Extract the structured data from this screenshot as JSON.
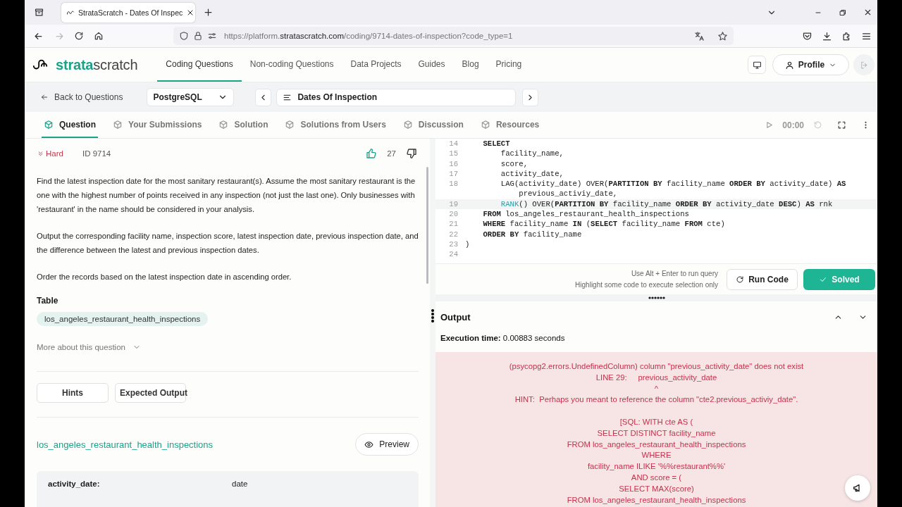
{
  "browser": {
    "tab_title": "StrataScratch - Dates Of Inspec",
    "url": {
      "prefix": "https://platform.",
      "domain": "stratascratch.com",
      "path": "/coding/9714-dates-of-inspection?code_type=1"
    }
  },
  "site": {
    "logo_a": "strata",
    "logo_b": "scratch",
    "profile": "Profile",
    "nav": [
      {
        "label": "Coding Questions",
        "selected": true
      },
      {
        "label": "Non-coding Questions",
        "selected": false
      },
      {
        "label": "Data Projects",
        "selected": false
      },
      {
        "label": "Guides",
        "selected": false
      },
      {
        "label": "Blog",
        "selected": false
      },
      {
        "label": "Pricing",
        "selected": false
      }
    ]
  },
  "toolbar": {
    "back": "Back to Questions",
    "language": "PostgreSQL",
    "question_title": "Dates Of Inspection"
  },
  "tabs": [
    {
      "label": "Question",
      "selected": true
    },
    {
      "label": "Your Submissions",
      "selected": false
    },
    {
      "label": "Solution",
      "selected": false
    },
    {
      "label": "Solutions from Users",
      "selected": false
    },
    {
      "label": "Discussion",
      "selected": false
    },
    {
      "label": "Resources",
      "selected": false
    }
  ],
  "timer": "00:00",
  "question": {
    "difficulty": "Hard",
    "id": "ID 9714",
    "likes": "27",
    "paragraphs": [
      "Find the latest inspection date for the most sanitary restaurant(s). Assume the most sanitary restaurant is the one with the highest number of points received in any inspection (not just the last one). Only businesses with 'restaurant' in the name should be considered in your analysis.",
      "Output the corresponding facility name, inspection score, latest inspection date, previous inspection date, and the difference between the latest and previous inspection dates.",
      "Order the records based on the latest inspection date in ascending order."
    ],
    "table_heading": "Table",
    "table_chip": "los_angeles_restaurant_health_inspections",
    "more": "More about this question",
    "buttons": [
      "Hints",
      "Expected Output"
    ],
    "dataset_link": "los_angeles_restaurant_health_inspections",
    "preview": "Preview",
    "schema": [
      {
        "column": "activity_date:",
        "type": "date"
      }
    ]
  },
  "editor": {
    "lines": [
      {
        "number": "14",
        "text": "    **SELECT**",
        "active": false
      },
      {
        "number": "15",
        "text": "        facility_name,",
        "active": false
      },
      {
        "number": "16",
        "text": "        score,",
        "active": false
      },
      {
        "number": "17",
        "text": "        activity_date,",
        "active": false
      },
      {
        "number": "18",
        "text": "        LAG(activity_date) OVER(**PARTITION BY** facility_name **ORDER BY** activity_date) **AS**",
        "active": false
      },
      {
        "text": "            previous_activiy_date,",
        "active": false
      },
      {
        "number": "19",
        "text": "        *RANK*() OVER(**PARTITION BY** facility_name **ORDER BY** activity_date **DESC**) **AS** rnk",
        "active": true
      },
      {
        "number": "20",
        "text": "    **FROM** los_angeles_restaurant_health_inspections",
        "active": false
      },
      {
        "number": "21",
        "text": "    **WHERE** facility_name **IN** (**SELECT** facility_name **FROM** cte)",
        "active": false
      },
      {
        "number": "22",
        "text": "    **ORDER BY** facility_name",
        "active": false
      },
      {
        "number": "23",
        "text": ")",
        "active": false
      },
      {
        "number": "24",
        "active": false
      }
    ],
    "hints": [
      "Use Alt + Enter to run query",
      "Highlight some code to execute selection only"
    ],
    "run": "Run Code",
    "status": "Solved"
  },
  "output": {
    "title": "Output",
    "execution_label": "Execution time:",
    "execution_value": "0.00883 seconds",
    "error_blocks": [
      [
        "(psycopg2.errors.UndefinedColumn) column \"previous_activity_date\" does not exist",
        "LINE 29:     previous_activity_date",
        "^",
        "HINT:  Perhaps you meant to reference the column \"cte2.previous_activiy_date\"."
      ],
      [
        "[SQL: WITH cte AS (",
        "SELECT DISTINCT facility_name",
        "FROM los_angeles_restaurant_health_inspections",
        "WHERE",
        "facility_name ILIKE '%%restaurant%%'",
        "AND score = (",
        "SELECT MAX(score)",
        "FROM los_angeles_restaurant_health_inspections"
      ]
    ]
  }
}
